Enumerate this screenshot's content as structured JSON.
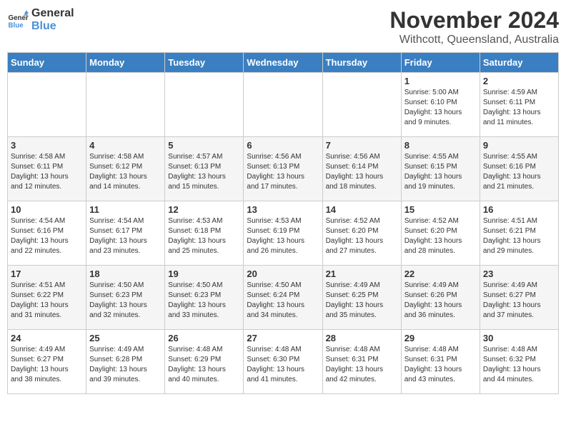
{
  "logo": {
    "line1": "General",
    "line2": "Blue"
  },
  "title": "November 2024",
  "subtitle": "Withcott, Queensland, Australia",
  "weekdays": [
    "Sunday",
    "Monday",
    "Tuesday",
    "Wednesday",
    "Thursday",
    "Friday",
    "Saturday"
  ],
  "weeks": [
    [
      {
        "day": "",
        "info": ""
      },
      {
        "day": "",
        "info": ""
      },
      {
        "day": "",
        "info": ""
      },
      {
        "day": "",
        "info": ""
      },
      {
        "day": "",
        "info": ""
      },
      {
        "day": "1",
        "info": "Sunrise: 5:00 AM\nSunset: 6:10 PM\nDaylight: 13 hours\nand 9 minutes."
      },
      {
        "day": "2",
        "info": "Sunrise: 4:59 AM\nSunset: 6:11 PM\nDaylight: 13 hours\nand 11 minutes."
      }
    ],
    [
      {
        "day": "3",
        "info": "Sunrise: 4:58 AM\nSunset: 6:11 PM\nDaylight: 13 hours\nand 12 minutes."
      },
      {
        "day": "4",
        "info": "Sunrise: 4:58 AM\nSunset: 6:12 PM\nDaylight: 13 hours\nand 14 minutes."
      },
      {
        "day": "5",
        "info": "Sunrise: 4:57 AM\nSunset: 6:13 PM\nDaylight: 13 hours\nand 15 minutes."
      },
      {
        "day": "6",
        "info": "Sunrise: 4:56 AM\nSunset: 6:13 PM\nDaylight: 13 hours\nand 17 minutes."
      },
      {
        "day": "7",
        "info": "Sunrise: 4:56 AM\nSunset: 6:14 PM\nDaylight: 13 hours\nand 18 minutes."
      },
      {
        "day": "8",
        "info": "Sunrise: 4:55 AM\nSunset: 6:15 PM\nDaylight: 13 hours\nand 19 minutes."
      },
      {
        "day": "9",
        "info": "Sunrise: 4:55 AM\nSunset: 6:16 PM\nDaylight: 13 hours\nand 21 minutes."
      }
    ],
    [
      {
        "day": "10",
        "info": "Sunrise: 4:54 AM\nSunset: 6:16 PM\nDaylight: 13 hours\nand 22 minutes."
      },
      {
        "day": "11",
        "info": "Sunrise: 4:54 AM\nSunset: 6:17 PM\nDaylight: 13 hours\nand 23 minutes."
      },
      {
        "day": "12",
        "info": "Sunrise: 4:53 AM\nSunset: 6:18 PM\nDaylight: 13 hours\nand 25 minutes."
      },
      {
        "day": "13",
        "info": "Sunrise: 4:53 AM\nSunset: 6:19 PM\nDaylight: 13 hours\nand 26 minutes."
      },
      {
        "day": "14",
        "info": "Sunrise: 4:52 AM\nSunset: 6:20 PM\nDaylight: 13 hours\nand 27 minutes."
      },
      {
        "day": "15",
        "info": "Sunrise: 4:52 AM\nSunset: 6:20 PM\nDaylight: 13 hours\nand 28 minutes."
      },
      {
        "day": "16",
        "info": "Sunrise: 4:51 AM\nSunset: 6:21 PM\nDaylight: 13 hours\nand 29 minutes."
      }
    ],
    [
      {
        "day": "17",
        "info": "Sunrise: 4:51 AM\nSunset: 6:22 PM\nDaylight: 13 hours\nand 31 minutes."
      },
      {
        "day": "18",
        "info": "Sunrise: 4:50 AM\nSunset: 6:23 PM\nDaylight: 13 hours\nand 32 minutes."
      },
      {
        "day": "19",
        "info": "Sunrise: 4:50 AM\nSunset: 6:23 PM\nDaylight: 13 hours\nand 33 minutes."
      },
      {
        "day": "20",
        "info": "Sunrise: 4:50 AM\nSunset: 6:24 PM\nDaylight: 13 hours\nand 34 minutes."
      },
      {
        "day": "21",
        "info": "Sunrise: 4:49 AM\nSunset: 6:25 PM\nDaylight: 13 hours\nand 35 minutes."
      },
      {
        "day": "22",
        "info": "Sunrise: 4:49 AM\nSunset: 6:26 PM\nDaylight: 13 hours\nand 36 minutes."
      },
      {
        "day": "23",
        "info": "Sunrise: 4:49 AM\nSunset: 6:27 PM\nDaylight: 13 hours\nand 37 minutes."
      }
    ],
    [
      {
        "day": "24",
        "info": "Sunrise: 4:49 AM\nSunset: 6:27 PM\nDaylight: 13 hours\nand 38 minutes."
      },
      {
        "day": "25",
        "info": "Sunrise: 4:49 AM\nSunset: 6:28 PM\nDaylight: 13 hours\nand 39 minutes."
      },
      {
        "day": "26",
        "info": "Sunrise: 4:48 AM\nSunset: 6:29 PM\nDaylight: 13 hours\nand 40 minutes."
      },
      {
        "day": "27",
        "info": "Sunrise: 4:48 AM\nSunset: 6:30 PM\nDaylight: 13 hours\nand 41 minutes."
      },
      {
        "day": "28",
        "info": "Sunrise: 4:48 AM\nSunset: 6:31 PM\nDaylight: 13 hours\nand 42 minutes."
      },
      {
        "day": "29",
        "info": "Sunrise: 4:48 AM\nSunset: 6:31 PM\nDaylight: 13 hours\nand 43 minutes."
      },
      {
        "day": "30",
        "info": "Sunrise: 4:48 AM\nSunset: 6:32 PM\nDaylight: 13 hours\nand 44 minutes."
      }
    ]
  ]
}
